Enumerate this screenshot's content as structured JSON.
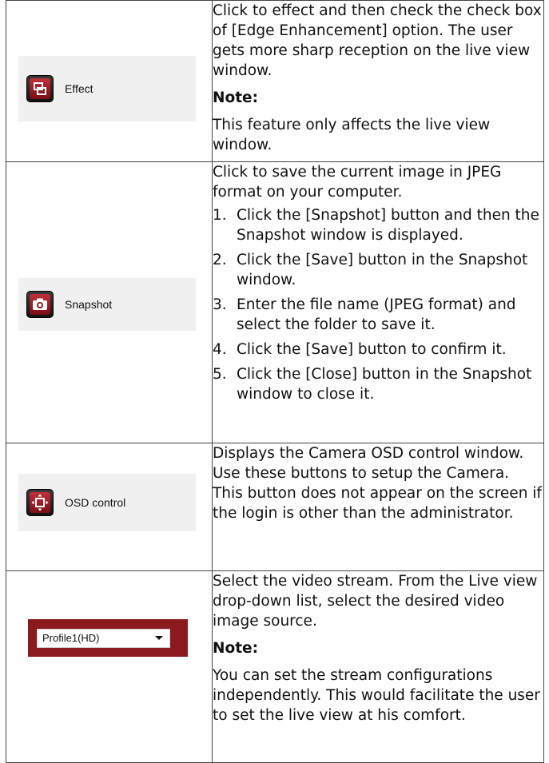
{
  "rows": [
    {
      "button": {
        "label": "Effect",
        "icon": "effect-icon"
      },
      "description": "Click to effect and then check the check box of [Edge Enhancement] option. The user gets more sharp reception on the live view window.",
      "note_label": "Note:",
      "note_text": "This feature only affects the live view window."
    },
    {
      "button": {
        "label": "Snapshot",
        "icon": "camera-icon"
      },
      "description": "Click to save the current image in JPEG format on your computer.",
      "steps": [
        {
          "num": "1.",
          "text": "Click the [Snapshot] button and then the Snapshot window is displayed."
        },
        {
          "num": "2.",
          "text": "Click the [Save] button in the Snapshot window."
        },
        {
          "num": "3.",
          "text": "Enter the file name (JPEG format) and select the folder to save it."
        },
        {
          "num": "4.",
          "text": "Click the [Save] button to confirm it."
        },
        {
          "num": "5.",
          "text": "Click the [Close] button in the Snapshot window to close it."
        }
      ]
    },
    {
      "button": {
        "label": "OSD control",
        "icon": "osd-control-icon"
      },
      "description": "Displays the Camera OSD control window. Use these buttons to setup the Camera. This button does not appear on the screen if the login is other than the administrator."
    },
    {
      "select": {
        "value": "Profile1(HD)",
        "icon": "chevron-down-icon"
      },
      "description": "Select the video stream. From the Live view drop-down list, select the desired video image source.",
      "note_label": "Note:",
      "note_text": "You can set the stream configurations independently. This would facilitate the user to set the live view at his comfort."
    }
  ],
  "colors": {
    "button_red": "#a01c26",
    "profile_bar": "#8b1a1f",
    "panel_bg": "#f0f0f0"
  }
}
